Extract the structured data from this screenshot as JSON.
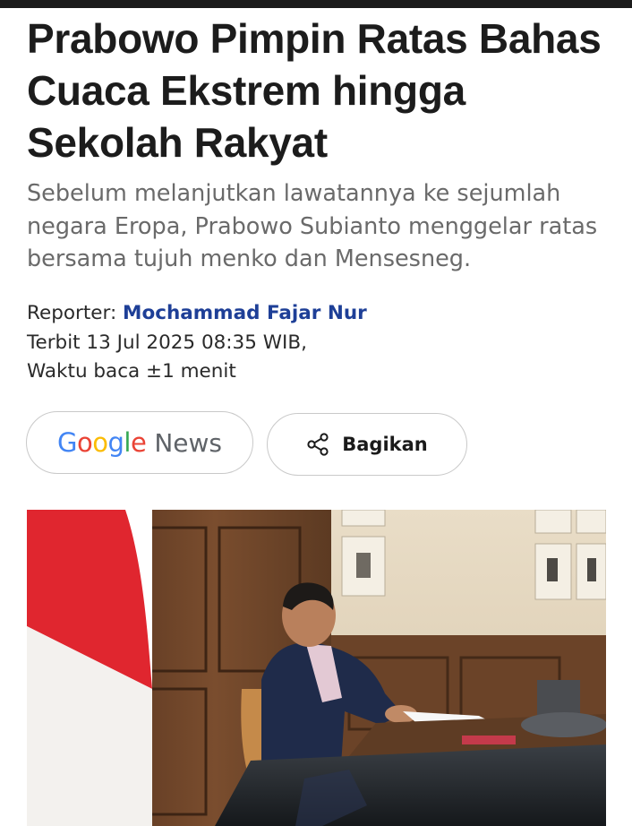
{
  "article": {
    "headline": "Prabowo Pimpin Ratas Bahas Cuaca Ekstrem hingga Sekolah Rakyat",
    "lead": "Sebelum melanjutkan lawatannya ke sejumlah negara Eropa, Prabowo Subianto menggelar ratas bersama tujuh menko dan Mensesneg.",
    "reporter_label": "Reporter: ",
    "reporter_name": "Mochammad Fajar Nur",
    "published": "Terbit 13 Jul 2025 08:35 WIB,",
    "read_time": "Waktu baca ±1 menit"
  },
  "actions": {
    "google_news": {
      "logo_letters": [
        "G",
        "o",
        "o",
        "g",
        "l",
        "e"
      ],
      "logo_colors": [
        "#4285F4",
        "#EA4335",
        "#FBBC05",
        "#4285F4",
        "#34A853",
        "#EA4335"
      ],
      "news_label": "News"
    },
    "share": {
      "label": "Bagikan",
      "icon": "share-icon"
    }
  },
  "colors": {
    "reporter_link": "#1e3f97",
    "lead_text": "#6a6a6a",
    "flag_red": "#e0262f"
  },
  "image": {
    "icon": "article-photo"
  }
}
